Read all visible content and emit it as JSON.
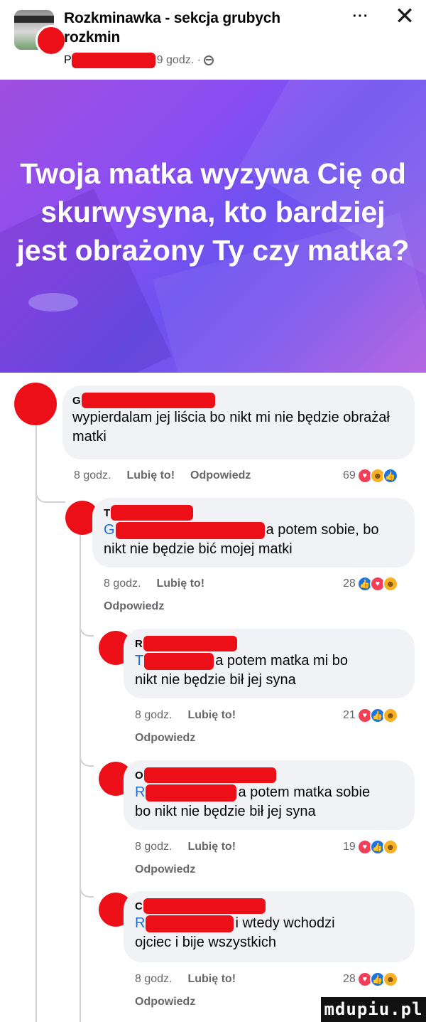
{
  "header": {
    "group_name": "Rozkminawka - sekcja grubych rozkmin",
    "poster_initial": "P",
    "time": "9 godz. ·",
    "more_label": "···",
    "close_label": "✕"
  },
  "post": {
    "banner_text": "Twoja matka wyzywa Cię od skurwysyna, kto bardziej jest obrażony Ty czy matka?"
  },
  "labels": {
    "like": "Lubię to!",
    "reply": "Odpowiedz"
  },
  "comments": [
    {
      "author_initial": "G",
      "mention_initial": "",
      "text": "wypierdalam jej liścia bo nikt mi nie będzie obrażał matki",
      "time": "8 godz.",
      "reaction_count": "69",
      "reactions": [
        "love",
        "haha",
        "like"
      ]
    },
    {
      "author_initial": "T",
      "mention_initial": "G",
      "text_after_mention": "a potem sobie, bo",
      "text": "nikt nie będzie bić mojej matki",
      "time": "8 godz.",
      "reaction_count": "28",
      "reactions": [
        "like",
        "love",
        "haha"
      ]
    },
    {
      "author_initial": "R",
      "mention_initial": "T",
      "text_after_mention": "a potem matka mi bo",
      "text": "nikt nie będzie bił jej syna",
      "time": "8 godz.",
      "reaction_count": "21",
      "reactions": [
        "love",
        "like",
        "haha"
      ]
    },
    {
      "author_initial": "O",
      "mention_initial": "R",
      "text_after_mention": "a potem matka sobie",
      "text": "bo nikt nie będzie bił jej syna",
      "time": "8 godz.",
      "reaction_count": "19",
      "reactions": [
        "love",
        "like",
        "haha"
      ]
    },
    {
      "author_initial": "C",
      "mention_initial": "R",
      "text_after_mention": "i wtedy wchodzi",
      "text": "ojciec i bije wszystkich",
      "time": "8 godz.",
      "reaction_count": "28",
      "reactions": [
        "love",
        "like",
        "haha"
      ]
    }
  ],
  "watermark": "mdupiu.pl",
  "colors": {
    "redaction": "#ec0f17",
    "banner_start": "#a04fe0",
    "banner_end": "#6c52f0",
    "bubble": "#f0f2f5",
    "mention": "#1a6fd9",
    "love": "#f33e58",
    "like": "#1b74e4",
    "haha": "#f7b125"
  }
}
